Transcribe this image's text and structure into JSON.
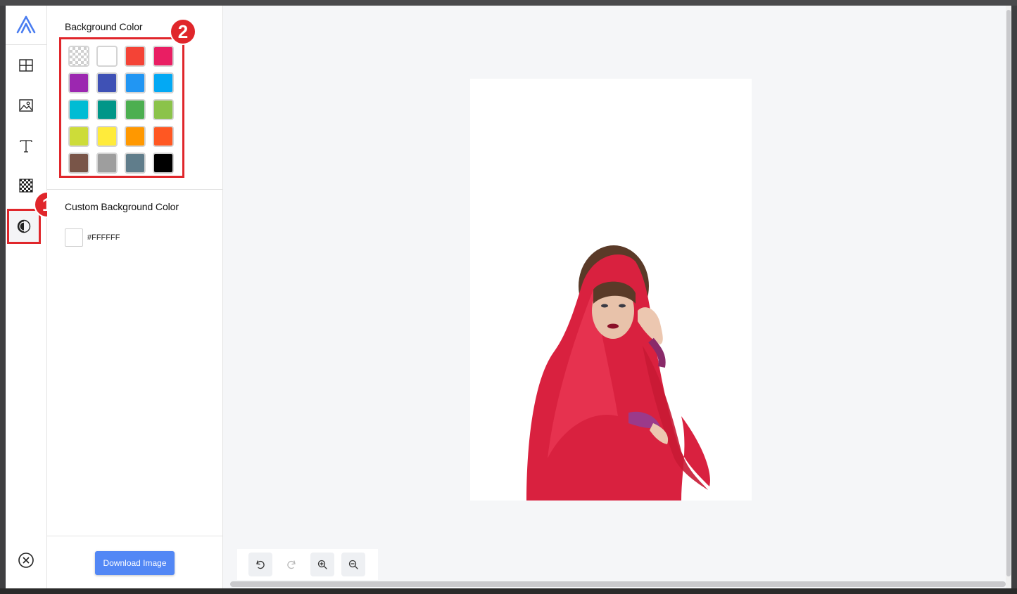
{
  "rail": {
    "items": [
      {
        "name": "layout-icon",
        "active": false
      },
      {
        "name": "image-icon",
        "active": false
      },
      {
        "name": "text-icon",
        "active": false
      },
      {
        "name": "transparency-icon",
        "active": false
      },
      {
        "name": "background-color-icon",
        "active": true
      }
    ],
    "close_icon": "close-circle-icon"
  },
  "panel": {
    "background_title": "Background Color",
    "swatches": [
      {
        "color": "transparent"
      },
      {
        "color": "#ffffff"
      },
      {
        "color": "#f44336"
      },
      {
        "color": "#e91e63"
      },
      {
        "color": "#9c27b0"
      },
      {
        "color": "#3f51b5"
      },
      {
        "color": "#2196f3"
      },
      {
        "color": "#03a9f4"
      },
      {
        "color": "#00bcd4"
      },
      {
        "color": "#009688"
      },
      {
        "color": "#4caf50"
      },
      {
        "color": "#8bc34a"
      },
      {
        "color": "#cddc39"
      },
      {
        "color": "#ffeb3b"
      },
      {
        "color": "#ff9800"
      },
      {
        "color": "#ff5722"
      },
      {
        "color": "#795548"
      },
      {
        "color": "#9e9e9e"
      },
      {
        "color": "#607d8b"
      },
      {
        "color": "#000000"
      }
    ],
    "custom_title": "Custom Background Color",
    "custom_value": "#FFFFFF",
    "download_label": "Download Image"
  },
  "annotations": {
    "badge1": "1",
    "badge2": "2",
    "highlight_color": "#e0262b"
  },
  "toolbar": {
    "undo_icon": "undo-icon",
    "redo_icon": "redo-icon",
    "redo_enabled": false,
    "zoom_in_icon": "zoom-in-icon",
    "zoom_out_icon": "zoom-out-icon"
  },
  "canvas": {
    "background": "#ffffff",
    "subject": "woman in red headscarf"
  },
  "colors": {
    "accent": "#5287f5",
    "canvas_bg": "#f5f6f8"
  }
}
